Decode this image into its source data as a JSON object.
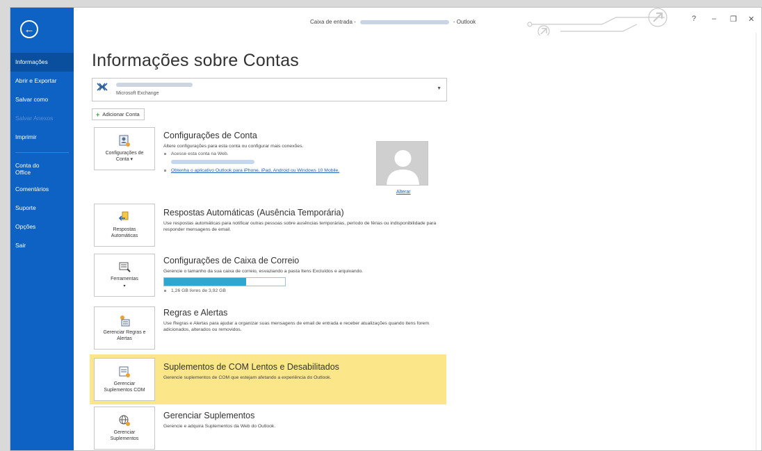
{
  "window": {
    "title_prefix": "Caixa de entrada -",
    "title_suffix": "- Outlook",
    "help": "?",
    "minimize": "–",
    "restore": "❐",
    "close": "✕"
  },
  "sidebar": {
    "back_icon": "back-arrow-icon",
    "items": [
      {
        "label": "Informações",
        "active": true
      },
      {
        "label": "Abrir e Exportar"
      },
      {
        "label": "Salvar como"
      },
      {
        "label": "Salvar Anexos",
        "disabled": true
      },
      {
        "label": "Imprimir"
      },
      {
        "label": "Conta do Office"
      },
      {
        "label": "Comentários"
      },
      {
        "label": "Suporte"
      },
      {
        "label": "Opções"
      },
      {
        "label": "Sair"
      }
    ]
  },
  "main": {
    "page_title": "Informações sobre Contas",
    "account": {
      "type": "Microsoft Exchange"
    },
    "add_account": "Adicionar Conta",
    "sections": {
      "account_settings": {
        "tile_label": "Configurações de Conta ▾",
        "title": "Configurações de Conta",
        "desc": "Altere configurações para esta conta ou configurar mais conexões.",
        "bullet1": "Acesse esta conta na Web.",
        "bullet2": "Obtenha o aplicativo Outlook para iPhone, iPad, Android ou Windows 10 Mobile.",
        "change_photo": "Alterar"
      },
      "auto_replies": {
        "tile_label": "Respostas Automáticas",
        "title": "Respostas Automáticas (Ausência Temporária)",
        "desc": "Use respostas automáticas para notificar outras pessoas sobre ausências temporárias, período de férias ou indisponibilidade para responder mensagens de email."
      },
      "mailbox": {
        "tile_label": "Ferramentas",
        "title": "Configurações de Caixa de Correio",
        "desc": "Gerencie o tamanho da sua caixa de correio, esvaziando a pasta Itens Excluídos e arquivando.",
        "usage_fraction": 0.68,
        "free_text": "1,26 GB livres de 3,92 GB"
      },
      "rules": {
        "tile_label": "Gerenciar Regras e Alertas",
        "title": "Regras e Alertas",
        "desc": "Use Regras e Alertas para ajudar a organizar suas mensagens de email de entrada e receber atualizações quando itens forem adicionados, alterados ou removidos."
      },
      "com_addins": {
        "tile_label": "Gerenciar Suplementos COM",
        "title": "Suplementos de COM Lentos e Desabilitados",
        "desc": "Gerencie suplementos de COM que estejam afetando a experiência do Outlook.",
        "highlight_color": "#fbe78a"
      },
      "addins": {
        "tile_label": "Gerenciar Suplementos",
        "title": "Gerenciar Suplementos",
        "desc": "Gerencie e adquira Suplementos da Web do Outlook."
      }
    }
  },
  "colors": {
    "sidebar": "#0d62c3",
    "accent": "#31a6cf",
    "link": "#1f5fb9"
  }
}
